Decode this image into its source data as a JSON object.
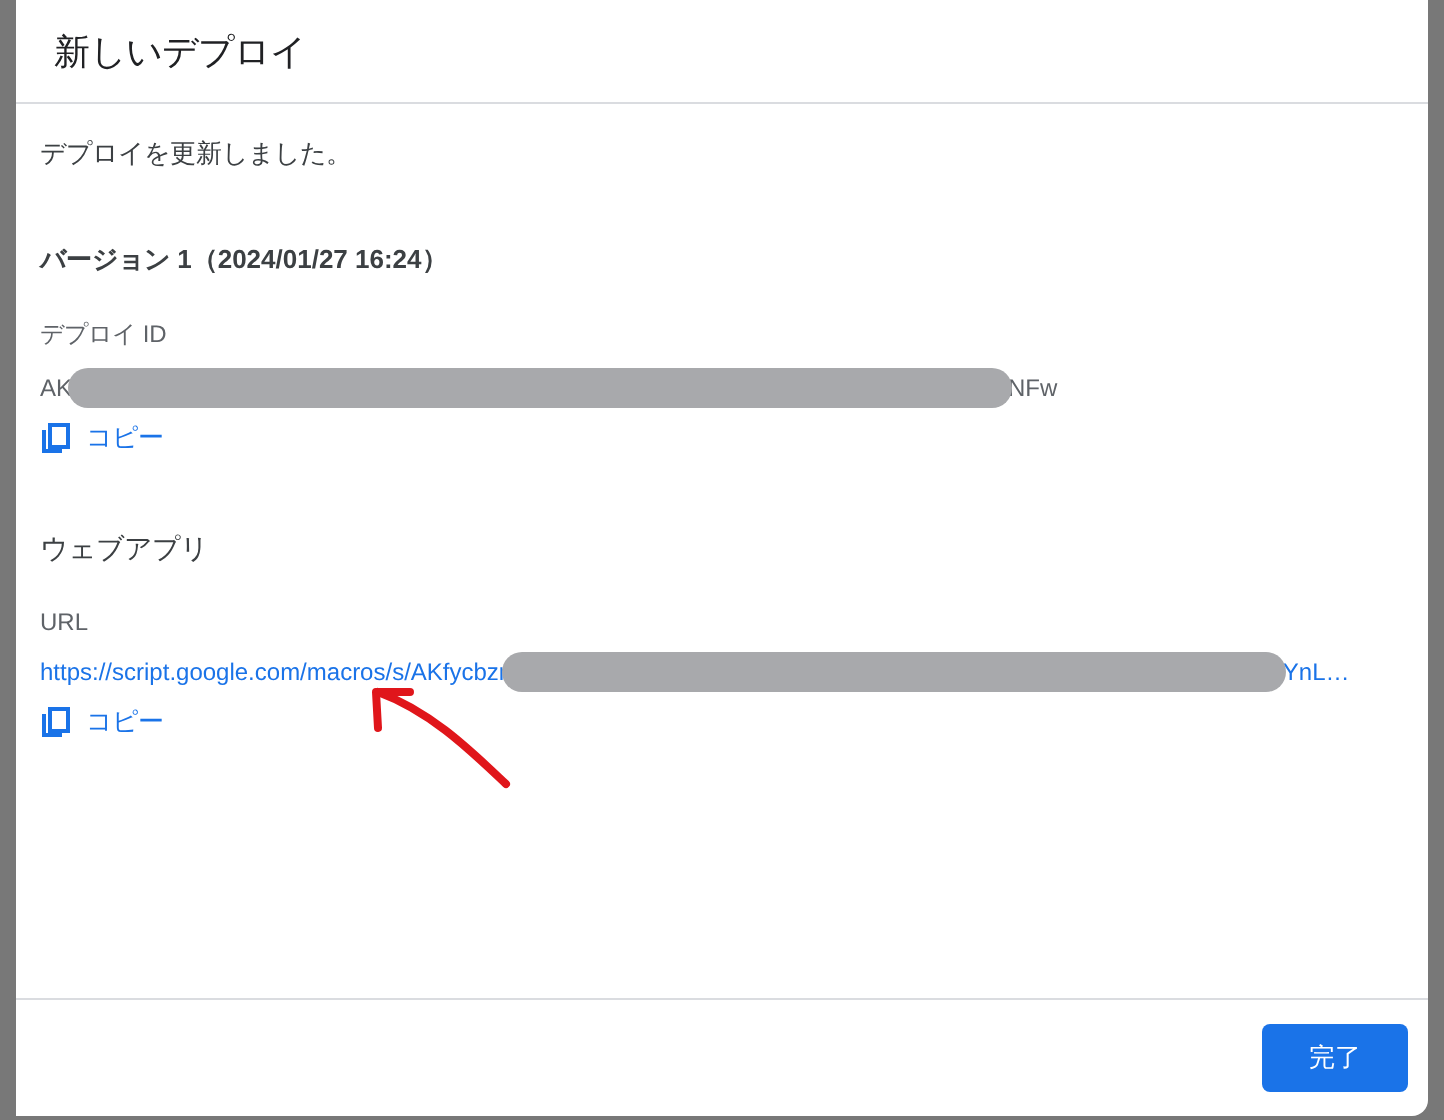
{
  "dialog": {
    "title": "新しいデプロイ",
    "message": "デプロイを更新しました。",
    "version": "バージョン 1（2024/01/27 16:24）",
    "deploy_id": {
      "label": "デプロイ ID",
      "value_start": "AK",
      "redacted": true,
      "value_end": "NFw",
      "copy": "コピー"
    },
    "web_app": {
      "heading": "ウェブアプリ",
      "label": "URL",
      "value_start": "https://script.google.com/macros/s/AKfycbzr",
      "redacted": true,
      "value_end": "YnL…",
      "copy": "コピー"
    },
    "buttons": [
      "完了"
    ]
  },
  "annotations": [
    {
      "kind": "arrow",
      "color": "#e0161b"
    }
  ]
}
